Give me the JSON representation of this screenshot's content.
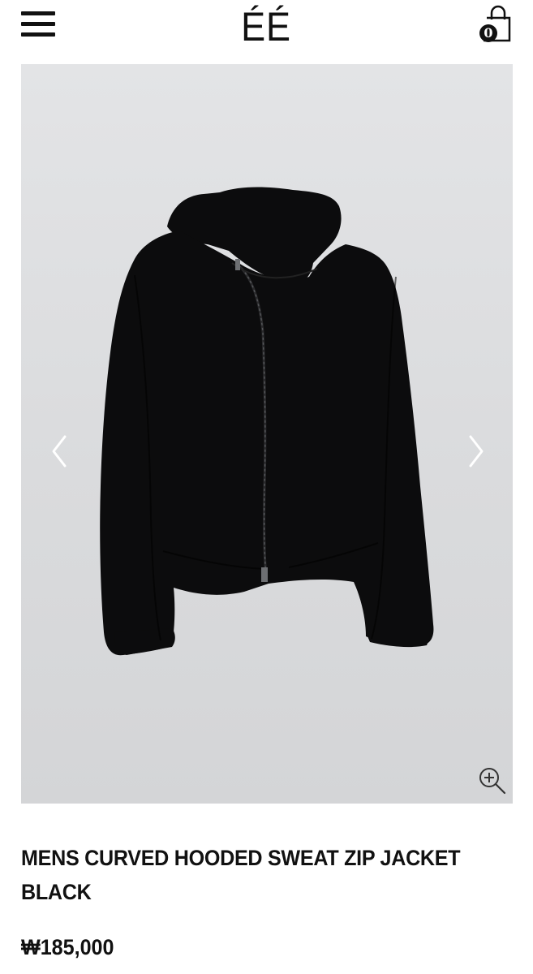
{
  "header": {
    "logo_text": "ÉÉ",
    "cart_count": "0",
    "icons": {
      "menu": "hamburger-menu-icon",
      "cart": "shopping-bag-icon"
    }
  },
  "gallery": {
    "image_description_icon": "product-photo",
    "prev_icon": "chevron-left-icon",
    "next_icon": "chevron-right-icon",
    "zoom_icon": "zoom-in-icon",
    "background_color": "#dfe0e2"
  },
  "product": {
    "title": "MENS CURVED HOODED SWEAT ZIP JACKET BLACK",
    "price": "₩185,000"
  }
}
